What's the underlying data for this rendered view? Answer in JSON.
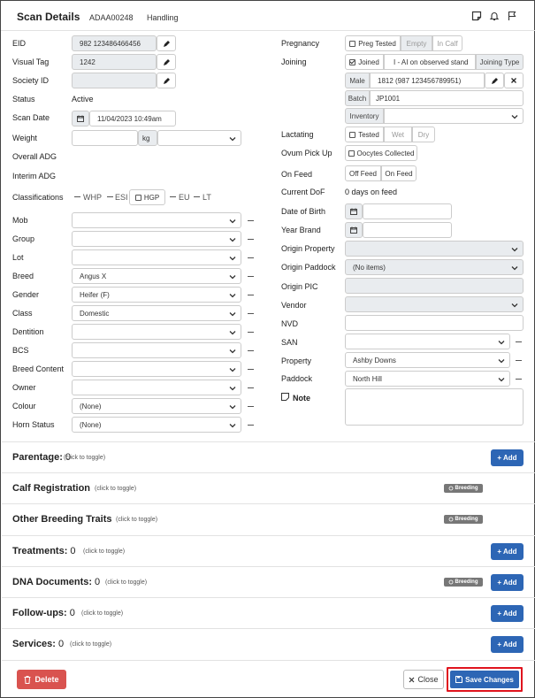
{
  "header": {
    "title": "Scan Details",
    "code": "ADAA00248",
    "mode": "Handling",
    "icons": [
      "note-icon",
      "bell-icon",
      "flag-icon"
    ]
  },
  "left": {
    "eid": {
      "label": "EID",
      "value": "982 123486466456"
    },
    "visual_tag": {
      "label": "Visual Tag",
      "value": "1242"
    },
    "society_id": {
      "label": "Society ID",
      "value": ""
    },
    "status": {
      "label": "Status",
      "value": "Active"
    },
    "scan_date": {
      "label": "Scan Date",
      "value": "11/04/2023 10:49am"
    },
    "weight": {
      "label": "Weight",
      "value": "",
      "unit": "kg"
    },
    "overall_adg": {
      "label": "Overall ADG"
    },
    "interim_adg": {
      "label": "Interim ADG"
    },
    "classifications": {
      "label": "Classifications",
      "options": [
        "WHP",
        "ESI",
        "HGP",
        "EU",
        "LT"
      ]
    },
    "selects": [
      {
        "label": "Mob",
        "value": ""
      },
      {
        "label": "Group",
        "value": ""
      },
      {
        "label": "Lot",
        "value": ""
      },
      {
        "label": "Breed",
        "value": "Angus X"
      },
      {
        "label": "Gender",
        "value": "Heifer (F)"
      },
      {
        "label": "Class",
        "value": "Domestic"
      },
      {
        "label": "Dentition",
        "value": ""
      },
      {
        "label": "BCS",
        "value": ""
      },
      {
        "label": "Breed Content",
        "value": ""
      },
      {
        "label": "Owner",
        "value": ""
      },
      {
        "label": "Colour",
        "value": "(None)"
      },
      {
        "label": "Horn Status",
        "value": "(None)"
      }
    ]
  },
  "right": {
    "pregnancy": {
      "label": "Pregnancy",
      "preg_tested": "Preg Tested",
      "empty": "Empty",
      "in_calf": "In Calf"
    },
    "joining": {
      "label": "Joining",
      "joined": "Joined",
      "method": "I - AI on observed stand",
      "type_btn": "Joining Type"
    },
    "sire": {
      "prefix": "Male",
      "value": "1812 (987 123456789951)"
    },
    "batch": {
      "prefix": "Batch",
      "value": "JP1001"
    },
    "inventory": {
      "prefix": "Inventory",
      "value": ""
    },
    "lactating": {
      "label": "Lactating",
      "tested": "Tested",
      "wet": "Wet",
      "dry": "Dry"
    },
    "ovum": {
      "label": "Ovum Pick Up",
      "oocytes": "Oocytes Collected"
    },
    "on_feed": {
      "label": "On Feed",
      "off": "Off Feed",
      "on": "On Feed"
    },
    "current_dof": {
      "label": "Current DoF",
      "value": "0 days on feed"
    },
    "dob": {
      "label": "Date of Birth",
      "value": ""
    },
    "year_brand": {
      "label": "Year Brand",
      "value": ""
    },
    "origin_property": {
      "label": "Origin Property",
      "value": ""
    },
    "origin_paddock": {
      "label": "Origin Paddock",
      "value": "(No items)"
    },
    "origin_pic": {
      "label": "Origin PIC",
      "value": ""
    },
    "vendor": {
      "label": "Vendor",
      "value": ""
    },
    "nvd": {
      "label": "NVD",
      "value": ""
    },
    "san": {
      "label": "SAN",
      "value": ""
    },
    "property": {
      "label": "Property",
      "value": "Ashby Downs"
    },
    "paddock": {
      "label": "Paddock",
      "value": "North Hill"
    },
    "note": {
      "label": "Note",
      "value": ""
    }
  },
  "sections": [
    {
      "title": "Parentage:",
      "count": "0",
      "toggle": "(click to toggle)",
      "add": "+ Add",
      "badge": ""
    },
    {
      "title": "Calf Registration",
      "count": "",
      "toggle": "(click to toggle)",
      "add": "",
      "badge": "Breeding"
    },
    {
      "title": "Other Breeding Traits",
      "count": "",
      "toggle": "(click to toggle)",
      "add": "",
      "badge": "Breeding"
    },
    {
      "title": "Treatments:",
      "count": "0",
      "toggle": "(click to toggle)",
      "add": "+ Add",
      "badge": ""
    },
    {
      "title": "DNA Documents:",
      "count": "0",
      "toggle": "(click to toggle)",
      "add": "+ Add",
      "badge": "Breeding"
    },
    {
      "title": "Follow-ups:",
      "count": "0",
      "toggle": "(click to toggle)",
      "add": "+ Add",
      "badge": ""
    },
    {
      "title": "Services:",
      "count": "0",
      "toggle": "(click to toggle)",
      "add": "+ Add",
      "badge": ""
    }
  ],
  "footer": {
    "delete": "Delete",
    "close": "Close",
    "save": "Save Changes"
  },
  "colors": {
    "primary": "#2d66b5",
    "danger": "#d9534f",
    "highlight": "#e0141e",
    "badge": "#777777"
  }
}
